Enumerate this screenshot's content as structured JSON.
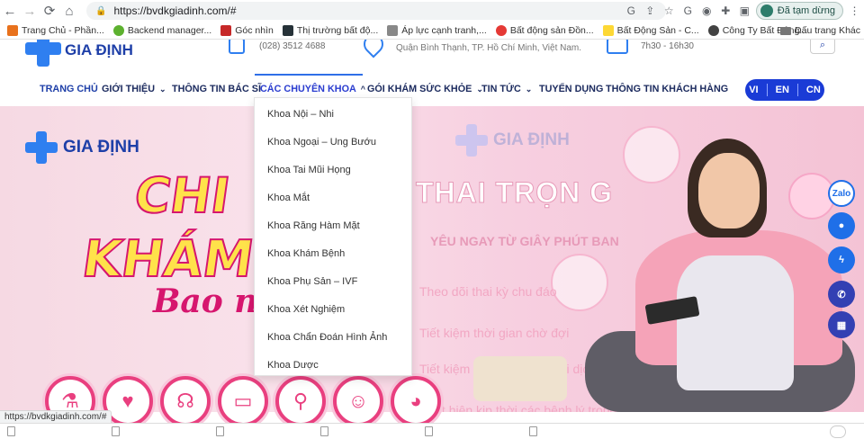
{
  "browser": {
    "url": "https://bvdkgiadinh.com/#",
    "profile_status": "Đã tạm dừng",
    "status_url": "https://bvdkgiadinh.com/#",
    "bookmarks": [
      {
        "label": "Trang Chủ - Phần...",
        "color": "#e8711c"
      },
      {
        "label": "Backend manager...",
        "color": "#5db12f"
      },
      {
        "label": "Góc nhìn",
        "color": "#c62828"
      },
      {
        "label": "Thị trường bất độ...",
        "color": "#263238"
      },
      {
        "label": "Áp lực cạnh tranh,...",
        "color": "#777777"
      },
      {
        "label": "Bất động sản Đồn...",
        "color": "#e53935"
      },
      {
        "label": "Bất Động Sản - C...",
        "color": "#fdd835"
      },
      {
        "label": "Công Ty Bất Động...",
        "color": "#424242"
      }
    ],
    "bookmark_folder": "Dấu trang Khác"
  },
  "site": {
    "brand": "GIA ĐỊNH",
    "phone": "(028) 3512 4688",
    "address": "Quận Bình Thạnh, TP. Hồ Chí Minh, Việt Nam.",
    "hours": "7h30 - 16h30",
    "nav": [
      {
        "label": "TRANG CHỦ",
        "chevron": ""
      },
      {
        "label": "GIỚI THIỆU",
        "chevron": "⌄"
      },
      {
        "label": "THÔNG TIN BÁC SĨ",
        "chevron": ""
      },
      {
        "label": "CÁC CHUYÊN KHOA",
        "chevron": "^"
      },
      {
        "label": "GÓI KHÁM SỨC KHỎE",
        "chevron": "⌄"
      },
      {
        "label": "TIN TỨC",
        "chevron": "⌄"
      },
      {
        "label": "TUYỂN DỤNG",
        "chevron": ""
      },
      {
        "label": "THÔNG TIN KHÁCH HÀNG",
        "chevron": ""
      }
    ],
    "languages": [
      "VI",
      "EN",
      "CN"
    ],
    "dropdown": [
      "Khoa Nội – Nhi",
      "Khoa Ngoại – Ung Bướu",
      "Khoa Tai Mũi Họng",
      "Khoa Mắt",
      "Khoa Răng Hàm Mặt",
      "Khoa Khám Bệnh",
      "Khoa Phụ Sản – IVF",
      "Khoa Xét Nghiệm",
      "Khoa Chẩn Đoán Hình Ảnh",
      "Khoa Dược"
    ],
    "banner": {
      "line1": "CHI",
      "line2": "KHÁM",
      "line3": "Bao n",
      "headline": "THAI TRỌN G",
      "sub": "YÊU NGAY TỪ GIÂY PHÚT BAN",
      "benefits": [
        "Theo dõi thai kỳ chu đáo",
        "Tiết kiệm thời gian chờ đợi",
        "Tiết kiệm ngân sách so với dịch vụ lẻ",
        "Phát hiện kịp thời các bệnh lý trong thai kỳ"
      ]
    },
    "contact": {
      "zalo": "Zalo"
    }
  }
}
